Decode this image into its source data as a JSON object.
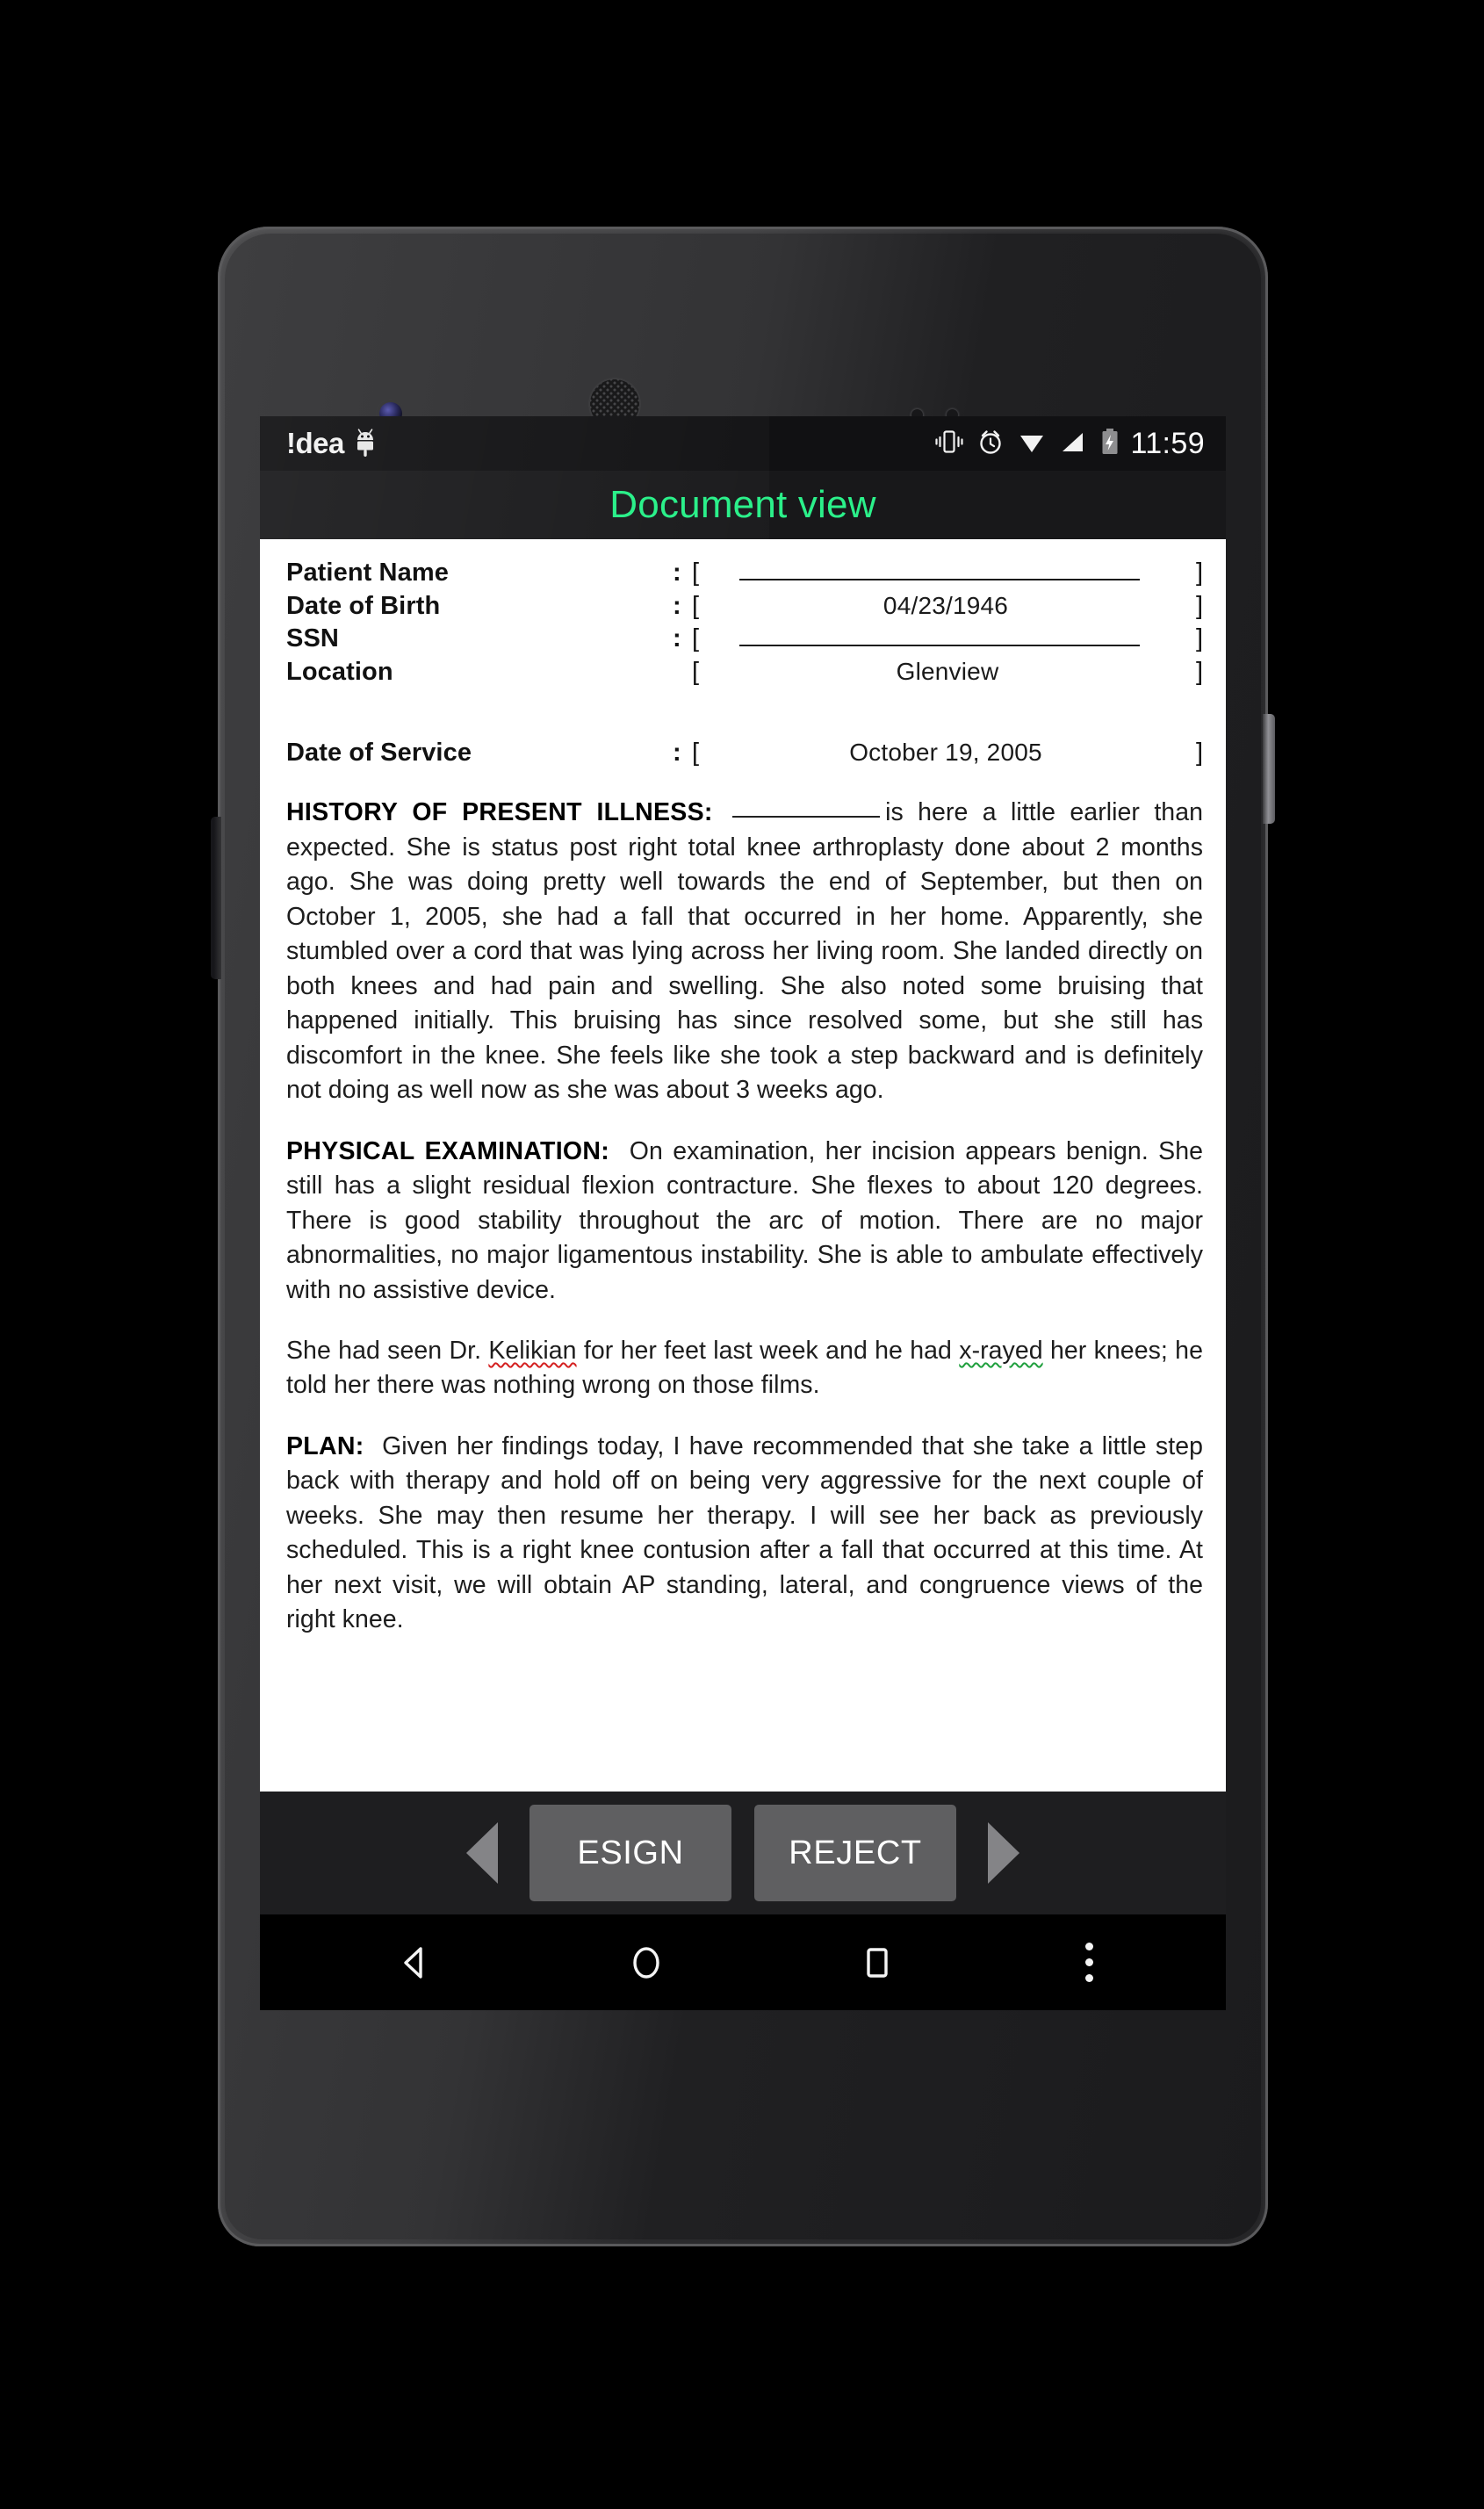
{
  "status_bar": {
    "carrier": "!dea",
    "time": "11:59",
    "icons": [
      "android-robot-icon",
      "vibrate-icon",
      "alarm-icon",
      "wifi-icon",
      "signal-icon",
      "battery-charging-icon"
    ]
  },
  "action_bar": {
    "title": "Document view",
    "title_color": "#2bf08a"
  },
  "document": {
    "fields": [
      {
        "label": "Patient Name",
        "separator": ":",
        "value": "",
        "blank": true
      },
      {
        "label": "Date of Birth",
        "separator": ":",
        "value": "04/23/1946",
        "blank": false
      },
      {
        "label": "SSN",
        "separator": ":",
        "value": "",
        "blank": true
      },
      {
        "label": "Location",
        "separator": "",
        "value": "Glenview",
        "blank": false
      }
    ],
    "date_of_service": {
      "label": "Date of Service",
      "separator": ":",
      "value": "October 19, 2005"
    },
    "sections": {
      "hpi_heading": "HISTORY OF PRESENT ILLNESS:",
      "hpi_body_after_blank": "is here a little earlier than expected.  She is status post right total knee arthroplasty done about 2 months ago.  She was doing pretty well towards the end of September, but then on October 1, 2005, she had a fall that occurred in her home.  Apparently, she stumbled over a cord that was lying across her living room.  She landed directly on both knees and had pain and swelling.  She also noted some bruising that happened initially.  This bruising has since resolved some, but she still has discomfort in the knee.  She feels like she took a step backward and is definitely not doing as well now as she was about 3 weeks ago.",
      "pe_heading": "PHYSICAL EXAMINATION:",
      "pe_body": "On examination, her incision appears benign.  She still has a slight residual flexion contracture.  She flexes to about 120 degrees.  There is good stability throughout the arc of motion.  There are no major abnormalities, no major ligamentous instability.  She is able to ambulate effectively with no assistive device.",
      "referral_part1": "She had seen Dr. ",
      "referral_misspelled": "Kelikian",
      "referral_part2": " for her feet last week and he had ",
      "referral_grammar": "x-rayed",
      "referral_part3": " her knees; he told her there was nothing wrong on those films.",
      "plan_heading": "PLAN:",
      "plan_body": "Given her findings today, I have recommended that she take a little step back with therapy and hold off on being very aggressive for the next couple of weeks.  She may then resume her therapy.  I will see her back as previously scheduled.  This is a right knee contusion after a fall that occurred at this time.  At her next visit, we will obtain AP standing, lateral, and congruence views of the right knee."
    }
  },
  "app_actions": {
    "prev_label": "previous-arrow-icon",
    "esign_label": "ESIGN",
    "reject_label": "REJECT",
    "next_label": "next-arrow-icon"
  },
  "nav_bar": {
    "back": "back-icon",
    "home": "home-icon",
    "recents": "recents-icon",
    "overflow": "overflow-menu-icon"
  }
}
